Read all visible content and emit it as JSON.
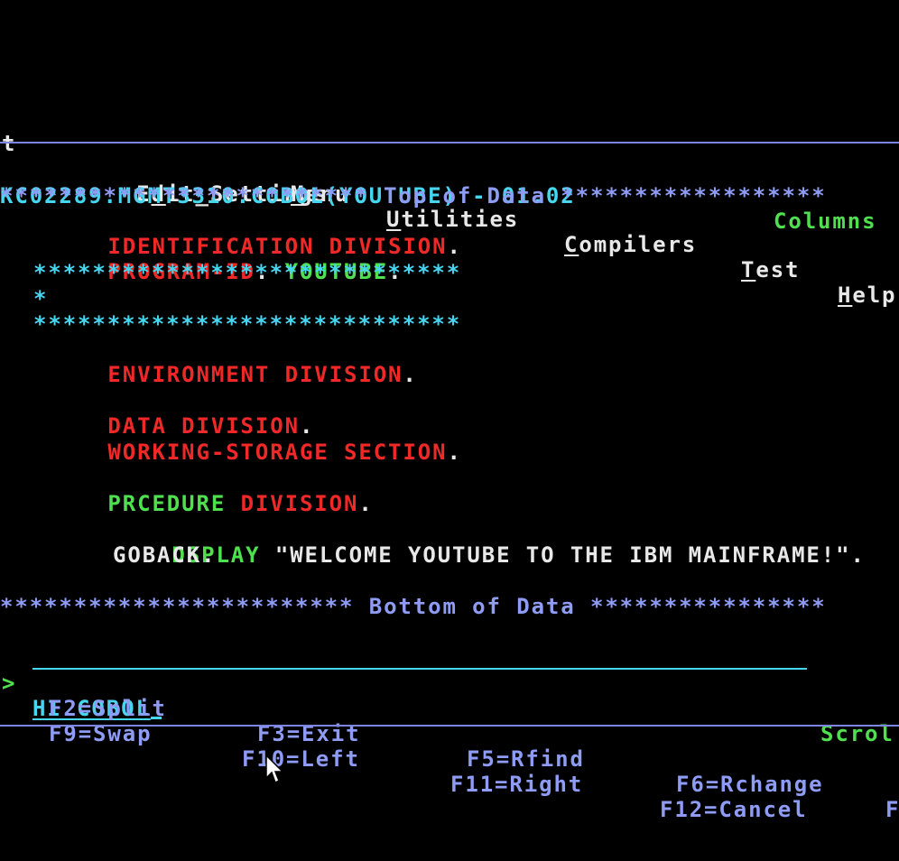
{
  "menu_bar": {
    "items": [
      {
        "label": "t",
        "mnemonic_index": -1
      },
      {
        "label": "Edit_Settings",
        "mnemonic_index": 1
      },
      {
        "label": "Menu",
        "mnemonic_index": 0
      },
      {
        "label": "Utilities",
        "mnemonic_index": 0
      },
      {
        "label": "Compilers",
        "mnemonic_index": 0
      },
      {
        "label": "Test",
        "mnemonic_index": 0
      },
      {
        "label": "Help",
        "mnemonic_index": 0
      }
    ]
  },
  "header": {
    "dataset": "KC02289.MGMT3310.COBOL(YOUTUBE) - 01.02",
    "columns_label": "Columns"
  },
  "editor": {
    "top_marker": "************************* Top of Data ******************",
    "bottom_marker": "************************ Bottom of Data ****************",
    "lines": [
      {
        "tokens": [
          {
            "text": "IDENTIFICATION DIVISION",
            "color": "red"
          },
          {
            "text": ".",
            "color": "white"
          }
        ]
      },
      {
        "tokens": [
          {
            "text": "PROGRAM-ID",
            "color": "red"
          },
          {
            "text": ". ",
            "color": "white"
          },
          {
            "text": "YOUTUBE",
            "color": "green"
          },
          {
            "text": ".",
            "color": "white"
          }
        ]
      },
      {
        "tokens": [
          {
            "text": "*****************************",
            "color": "cyan"
          }
        ]
      },
      {
        "tokens": [
          {
            "text": "*",
            "color": "cyan"
          }
        ]
      },
      {
        "tokens": [
          {
            "text": "*****************************",
            "color": "cyan"
          }
        ]
      },
      {
        "tokens": [
          {
            "text": "ENVIRONMENT DIVISION",
            "color": "red"
          },
          {
            "text": ".",
            "color": "white"
          }
        ]
      },
      {
        "tokens": [
          {
            "text": "DATA DIVISION",
            "color": "red"
          },
          {
            "text": ".",
            "color": "white"
          }
        ]
      },
      {
        "tokens": [
          {
            "text": "WORKING-STORAGE SECTION",
            "color": "red"
          },
          {
            "text": ".",
            "color": "white"
          }
        ]
      },
      {
        "tokens": [
          {
            "text": "PRCEDURE ",
            "color": "green"
          },
          {
            "text": "DIVISION",
            "color": "red"
          },
          {
            "text": ".",
            "color": "white"
          }
        ]
      },
      {
        "tokens": [
          {
            "text": "DSPLAY ",
            "color": "green"
          },
          {
            "text": "\"WELCOME YOUTUBE TO THE IBM MAINFRAME!\".",
            "color": "white"
          }
        ]
      },
      {
        "tokens": [
          {
            "text": "GOBACK.",
            "color": "white"
          }
        ]
      }
    ]
  },
  "command": {
    "prompt": ">",
    "value": "HI COBOL",
    "scroll_label": "Scrol"
  },
  "function_keys": {
    "row1": [
      "F2=Split",
      "F3=Exit",
      "F5=Rfind",
      "F6=Rchange",
      "F"
    ],
    "row2": [
      "F9=Swap",
      "F10=Left",
      "F11=Right",
      "F12=Cancel"
    ]
  },
  "colors": {
    "background": "#000000",
    "white": "#e8e8e8",
    "cyan": "#46d6f0",
    "green": "#4fe04f",
    "red": "#f02828",
    "blue": "#8f9cf5",
    "separator": "#7c86e0"
  },
  "icons": {
    "pointer": "mouse-pointer-icon"
  }
}
